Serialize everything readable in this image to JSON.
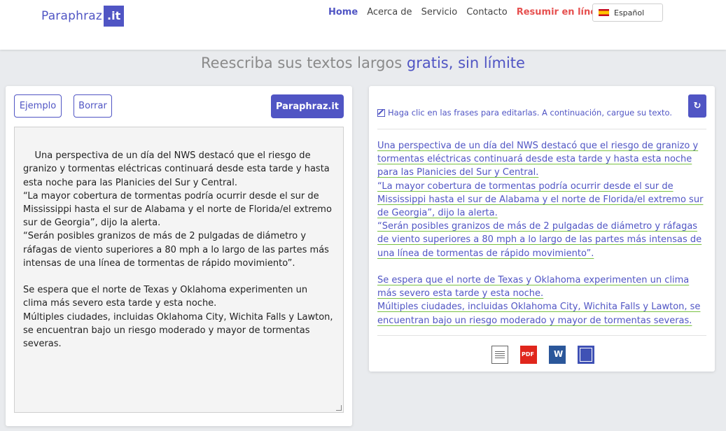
{
  "nav": {
    "logo_text": "Paraphraz",
    "logo_suffix": ".it",
    "links": [
      "Home",
      "Acerca de",
      "Servicio",
      "Contacto",
      "Resumir en línea"
    ],
    "language": "Español",
    "brand_color": "#5055c4",
    "accent_color": "#e6504f"
  },
  "headline": {
    "prefix": "Reescriba sus textos largos ",
    "highlight": "gratis, sin límite"
  },
  "input_panel": {
    "buttons": {
      "ejemplo": "Ejemplo",
      "borrar": "Borrar",
      "submit": "Paraphraz.it"
    },
    "text": "Una perspectiva de un día del NWS destacó que el riesgo de granizo y tormentas eléctricas continuará desde esta tarde y hasta esta noche para las Planicies del Sur y Central.\n“La mayor cobertura de tormentas podría ocurrir desde el sur de Mississippi hasta el sur de Alabama y el norte de Florida/el extremo sur de Georgia”, dijo la alerta.\n“Serán posibles granizos de más de 2 pulgadas de diámetro y ráfagas de viento superiores a 80 mph a lo largo de las partes más intensas de una línea de tormentas de rápido movimiento”.\n\nSe espera que el norte de Texas y Oklahoma experimenten un clima más severo esta tarde y esta noche.\nMúltiples ciudades, incluidas Oklahoma City, Wichita Falls y Lawton, se encuentran bajo un riesgo moderado y mayor de tormentas severas."
  },
  "output_panel": {
    "hint": "Haga clic en las frases para editarlas. A continuación, cargue su texto.",
    "refresh_icon": "↻",
    "sentences": [
      "Una perspectiva de un día del NWS destacó que el riesgo de granizo y tormentas eléctricas continuará desde esta tarde y hasta esta noche para las Planicies del Sur y Central.",
      "“La mayor cobertura de tormentas podría ocurrir desde el sur de Mississippi hasta el sur de Alabama y el norte de Florida/el extremo sur de Georgia”, dijo la alerta.",
      "“Serán posibles granizos de más de 2 pulgadas de diámetro y ráfagas de viento superiores a 80 mph a lo largo de las partes más intensas de una línea de tormentas de rápido movimiento”.",
      "",
      "Se espera que el norte de Texas y Oklahoma experimenten un clima más severo esta tarde y esta noche.",
      "Múltiples ciudades, incluidas Oklahoma City, Wichita Falls y Lawton, se encuentran bajo un riesgo moderado y mayor de tormentas severas."
    ],
    "downloads": [
      "txt-file-icon",
      "pdf-file-icon",
      "word-file-icon",
      "copy-icon"
    ],
    "pdf_label": "PDF",
    "word_label": "W"
  }
}
